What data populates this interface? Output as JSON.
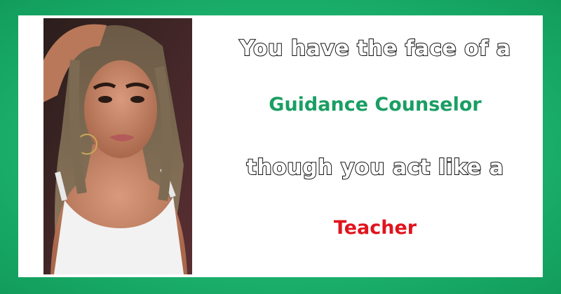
{
  "line_intro": "You have the face of a",
  "face_role": "Guidance Counselor",
  "line_middle": "though you act like a",
  "act_role": "Teacher",
  "colors": {
    "background": "#1fb873",
    "face_role": "#1a9e63",
    "act_role": "#e0141e",
    "outline_text_fill": "#ffffff",
    "outline_text_stroke": "#111111"
  }
}
